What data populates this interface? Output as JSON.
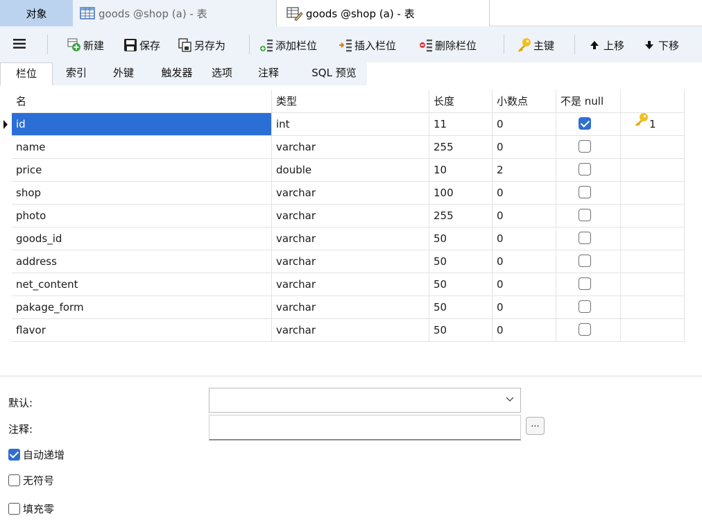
{
  "doc_tabs": [
    {
      "label": "对象"
    },
    {
      "label": "goods @shop (a) - 表"
    },
    {
      "label": "goods @shop (a) - 表"
    }
  ],
  "toolbar": {
    "new": "新建",
    "save": "保存",
    "save_as": "另存为",
    "add_column": "添加栏位",
    "insert_column": "插入栏位",
    "delete_column": "删除栏位",
    "primary_key": "主键",
    "move_up": "上移",
    "move_down": "下移"
  },
  "sub_tabs": [
    "栏位",
    "索引",
    "外键",
    "触发器",
    "选项",
    "注释",
    "SQL 预览"
  ],
  "grid": {
    "headers": [
      "名",
      "类型",
      "长度",
      "小数点",
      "不是 null",
      ""
    ],
    "rows": [
      {
        "name": "id",
        "type": "int",
        "length": "11",
        "decimals": "0",
        "not_null": true,
        "key": "1"
      },
      {
        "name": "name",
        "type": "varchar",
        "length": "255",
        "decimals": "0",
        "not_null": false,
        "key": ""
      },
      {
        "name": "price",
        "type": "double",
        "length": "10",
        "decimals": "2",
        "not_null": false,
        "key": ""
      },
      {
        "name": "shop",
        "type": "varchar",
        "length": "100",
        "decimals": "0",
        "not_null": false,
        "key": ""
      },
      {
        "name": "photo",
        "type": "varchar",
        "length": "255",
        "decimals": "0",
        "not_null": false,
        "key": ""
      },
      {
        "name": "goods_id",
        "type": "varchar",
        "length": "50",
        "decimals": "0",
        "not_null": false,
        "key": ""
      },
      {
        "name": "address",
        "type": "varchar",
        "length": "50",
        "decimals": "0",
        "not_null": false,
        "key": ""
      },
      {
        "name": "net_content",
        "type": "varchar",
        "length": "50",
        "decimals": "0",
        "not_null": false,
        "key": ""
      },
      {
        "name": "pakage_form",
        "type": "varchar",
        "length": "50",
        "decimals": "0",
        "not_null": false,
        "key": ""
      },
      {
        "name": "flavor",
        "type": "varchar",
        "length": "50",
        "decimals": "0",
        "not_null": false,
        "key": ""
      }
    ]
  },
  "props": {
    "default_label": "默认:",
    "comment_label": "注释:",
    "default_value": "",
    "comment_value": "",
    "ellipsis": "...",
    "options": [
      {
        "label": "自动递增",
        "checked": true
      },
      {
        "label": "无符号",
        "checked": false
      },
      {
        "label": "填充零",
        "checked": false
      }
    ]
  },
  "colors": {
    "accent": "#2f6fcf",
    "selection": "#2b6fd6",
    "tab_active": "#bcd3ef",
    "toolbar_bg": "#eef3f9",
    "key_gold": "#e8b318"
  }
}
